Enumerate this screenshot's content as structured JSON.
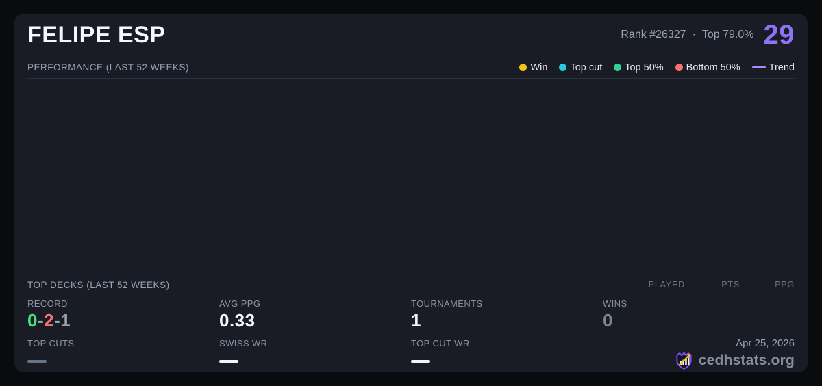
{
  "colors": {
    "page_bg": "#0a0b0f",
    "card_bg": "#1a1c25",
    "divider": "#2b3040",
    "score": "#8d72f5",
    "win": "#f0c419",
    "top_cut": "#2bc8e4",
    "top_50": "#32d296",
    "bottom_50": "#f87171",
    "trend": "#a78bfa",
    "record_win": "#4ade80",
    "record_loss": "#f87171",
    "record_draw": "#94a3b8",
    "zero_value": "#7d8595",
    "white_value": "#f3f5f8",
    "dash_gray": "#64748b",
    "dash_white": "#f1f5f9"
  },
  "header": {
    "title": "FELIPE ESP",
    "rank": "Rank #26327",
    "separator": "·",
    "top_percent": "Top 79.0%",
    "score": "29"
  },
  "performance": {
    "label": "PERFORMANCE (LAST 52 WEEKS)",
    "legend": [
      {
        "label": "Win"
      },
      {
        "label": "Top cut"
      },
      {
        "label": "Top 50%"
      },
      {
        "label": "Bottom 50%"
      },
      {
        "label": "Trend"
      }
    ]
  },
  "top_decks": {
    "label": "TOP DECKS (LAST 52 WEEKS)",
    "columns": [
      "PLAYED",
      "PTS",
      "PPG"
    ]
  },
  "stats": {
    "record": {
      "label": "RECORD",
      "wins": "0",
      "losses": "2",
      "draws": "1",
      "separator": "-"
    },
    "avg_ppg": {
      "label": "AVG PPG",
      "value": "0.33"
    },
    "tournaments": {
      "label": "TOURNAMENTS",
      "value": "1"
    },
    "wins": {
      "label": "WINS",
      "value": "0"
    },
    "top_cuts": {
      "label": "TOP CUTS"
    },
    "swiss_wr": {
      "label": "SWISS WR"
    },
    "top_cut_wr": {
      "label": "TOP CUT WR"
    }
  },
  "footer": {
    "date": "Apr 25, 2026",
    "brand": "cedhstats.org"
  }
}
